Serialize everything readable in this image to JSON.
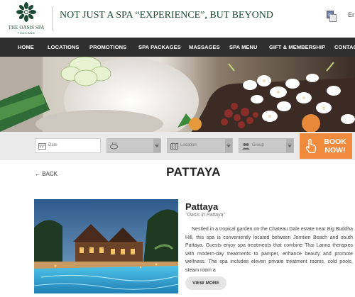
{
  "header": {
    "logo_name": "THE OASIS SPA",
    "logo_sub": "THAILAND",
    "tagline": "NOT JUST A SPA “EXPERIENCE”, BUT BEYOND",
    "language": "Er",
    "translate_icon": "translate-icon"
  },
  "nav": {
    "items": [
      "HOME",
      "LOCATIONS",
      "PROMOTIONS",
      "SPA PACKAGES",
      "MASSAGES",
      "SPA MENU",
      "GIFT & MEMBERSHIP",
      "CONTACT"
    ]
  },
  "booking": {
    "date_placeholder": "Date",
    "location_placeholder": "Location",
    "group_placeholder": "Group",
    "book_label": "BOOK NOW!"
  },
  "content": {
    "back_label": "← BACK",
    "page_title": "PATTAYA",
    "spa_name": "Pattaya",
    "spa_subtitle": "\"Oasis in Pattaya\"",
    "description": "Nestled in a tropical garden on the Chateau Dale estate near Big Buddha Hill, this spa is conveniently located between Jomtien Beach and south Pattaya. Guests enjoy spa treatments that combine Thai Lanna therapies with modern-day treatments to pamper, enhance beauty and promote wellness. The spa includes eleven private treatment rooms, cold pools, steam room a",
    "more_label": "VIEW MORE"
  },
  "colors": {
    "brand_green": "#1d4a35",
    "nav_bg": "#2f2f2f",
    "book_orange": "#f08b3d"
  }
}
